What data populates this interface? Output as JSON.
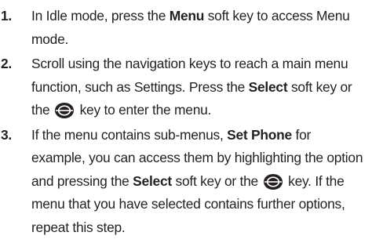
{
  "steps": [
    {
      "number": "1.",
      "text_1": "In Idle mode, press the ",
      "bold_1": "Menu",
      "text_2": " soft key to access Menu mode."
    },
    {
      "number": "2.",
      "text_1": "Scroll using the navigation keys to reach a main menu function, such as Settings. Press the ",
      "bold_1": "Select",
      "text_2": " soft key or the ",
      "icon": "navigation-key-icon",
      "text_3": " key to enter the menu."
    },
    {
      "number": "3.",
      "text_1": "If the menu contains sub-menus, ",
      "bold_1": "Set Phone",
      "text_2": " for example, you can access them by highlighting the option and pressing the ",
      "bold_2": "Select",
      "text_3": " soft key or the ",
      "icon": "navigation-key-icon",
      "text_4": " key. If the menu that you have selected contains further options, repeat this step."
    }
  ]
}
